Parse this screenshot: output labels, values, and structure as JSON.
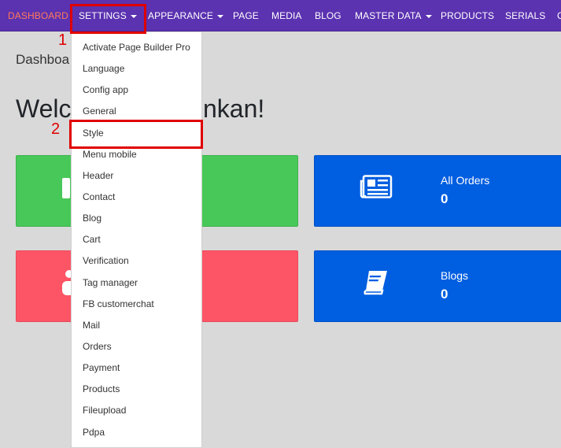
{
  "nav": {
    "items": [
      {
        "label": "DASHBOARD"
      },
      {
        "label": "SETTINGS"
      },
      {
        "label": "APPEARANCE"
      },
      {
        "label": "PAGE"
      },
      {
        "label": "MEDIA"
      },
      {
        "label": "BLOG"
      },
      {
        "label": "MASTER DATA"
      },
      {
        "label": "PRODUCTS"
      },
      {
        "label": "SERIALS"
      },
      {
        "label": "C"
      }
    ]
  },
  "page": {
    "title": "Dashboa",
    "welcome_left": "Welc",
    "welcome_right": "nkan!"
  },
  "cards": {
    "orders": {
      "label": "All Orders",
      "value": "0"
    },
    "blogs": {
      "label": "Blogs",
      "value": "0"
    }
  },
  "settings_menu": {
    "items": [
      {
        "label": "Activate Page Builder Pro"
      },
      {
        "label": "Language"
      },
      {
        "label": "Config app"
      },
      {
        "label": "General"
      },
      {
        "label": "Style"
      },
      {
        "label": "Menu mobile"
      },
      {
        "label": "Header"
      },
      {
        "label": "Contact"
      },
      {
        "label": "Blog"
      },
      {
        "label": "Cart"
      },
      {
        "label": "Verification"
      },
      {
        "label": "Tag manager"
      },
      {
        "label": "FB customerchat"
      },
      {
        "label": "Mail"
      },
      {
        "label": "Orders"
      },
      {
        "label": "Payment"
      },
      {
        "label": "Products"
      },
      {
        "label": "Fileupload"
      },
      {
        "label": "Pdpa"
      }
    ]
  },
  "annotations": {
    "step1": "1",
    "step2": "2"
  },
  "colors": {
    "navbar": "#5b32b0",
    "active_nav": "#ff7a59",
    "card_green": "#48c858",
    "card_red": "#fd5566",
    "card_blue": "#005ee0",
    "annotation": "#e00000"
  }
}
